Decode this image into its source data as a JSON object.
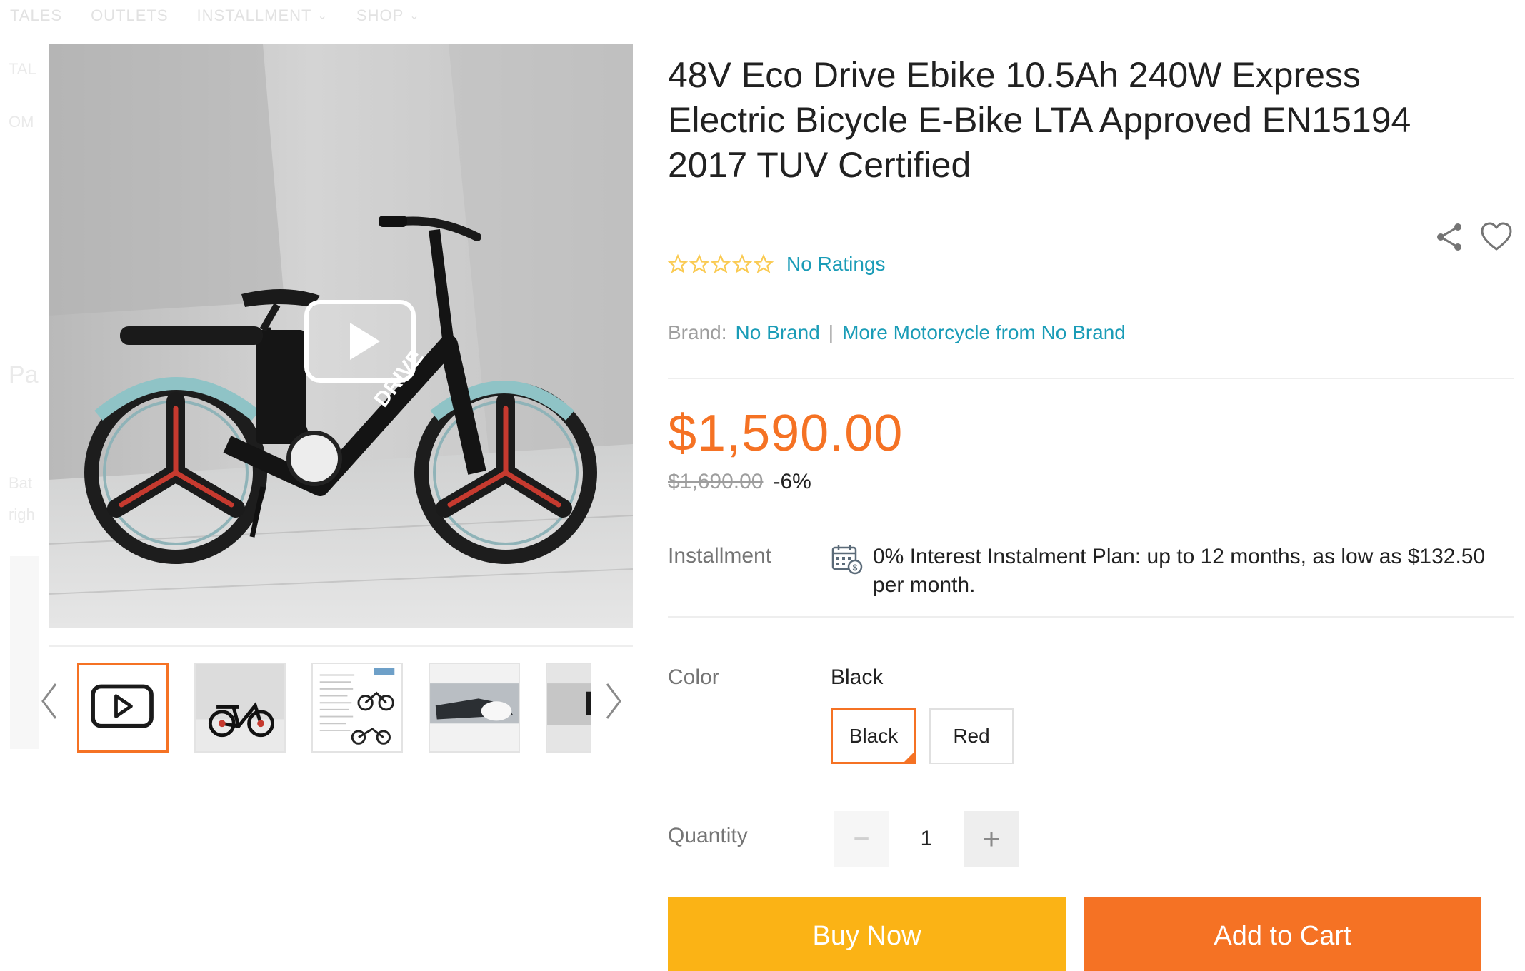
{
  "nav": {
    "items": [
      {
        "label": "TALES",
        "dropdown": false
      },
      {
        "label": "OUTLETS",
        "dropdown": false
      },
      {
        "label": "INSTALLMENT",
        "dropdown": true
      },
      {
        "label": "SHOP",
        "dropdown": true
      }
    ]
  },
  "left_rail": {
    "fragments": [
      "TAL",
      "OM",
      "Pa",
      "Bat",
      "righ"
    ]
  },
  "gallery": {
    "main_image": "bike-photo",
    "play_icon": "play-icon",
    "prev_icon": "chevron-left-icon",
    "next_icon": "chevron-right-icon",
    "thumbnails": [
      {
        "kind": "video",
        "icon": "play-icon",
        "active": true
      },
      {
        "kind": "photo-bike",
        "active": false
      },
      {
        "kind": "photo-spec-sheet",
        "active": false
      },
      {
        "kind": "photo-detail",
        "active": false
      },
      {
        "kind": "photo-partial",
        "active": false
      }
    ]
  },
  "product": {
    "title": "48V Eco Drive Ebike 10.5Ah 240W Express Electric Bicycle E-Bike LTA Approved EN15194 2017 TUV Certified",
    "rating": {
      "stars": 0,
      "max": 5,
      "label": "No Ratings"
    },
    "brand": {
      "label": "Brand:",
      "value": "No Brand",
      "more": "More Motorcycle from No Brand"
    },
    "price": "$1,590.00",
    "original_price": "$1,690.00",
    "discount": "-6%",
    "installment": {
      "label": "Installment",
      "text": "0% Interest Instalment Plan: up to 12 months, as low as $132.50 per month.",
      "icon": "calendar-dollar-icon"
    },
    "color": {
      "label": "Color",
      "selected": "Black",
      "options": [
        "Black",
        "Red"
      ]
    },
    "quantity": {
      "label": "Quantity",
      "value": "1",
      "minus": "−",
      "plus": "+"
    },
    "buttons": {
      "buy_now": "Buy Now",
      "add_to_cart": "Add to Cart"
    },
    "icons": {
      "share": "share-icon",
      "wishlist": "heart-icon"
    }
  },
  "colors": {
    "accent": "#f57224",
    "buy_now": "#fbb315",
    "link": "#1a9cb7",
    "star_outline": "#faca51"
  }
}
